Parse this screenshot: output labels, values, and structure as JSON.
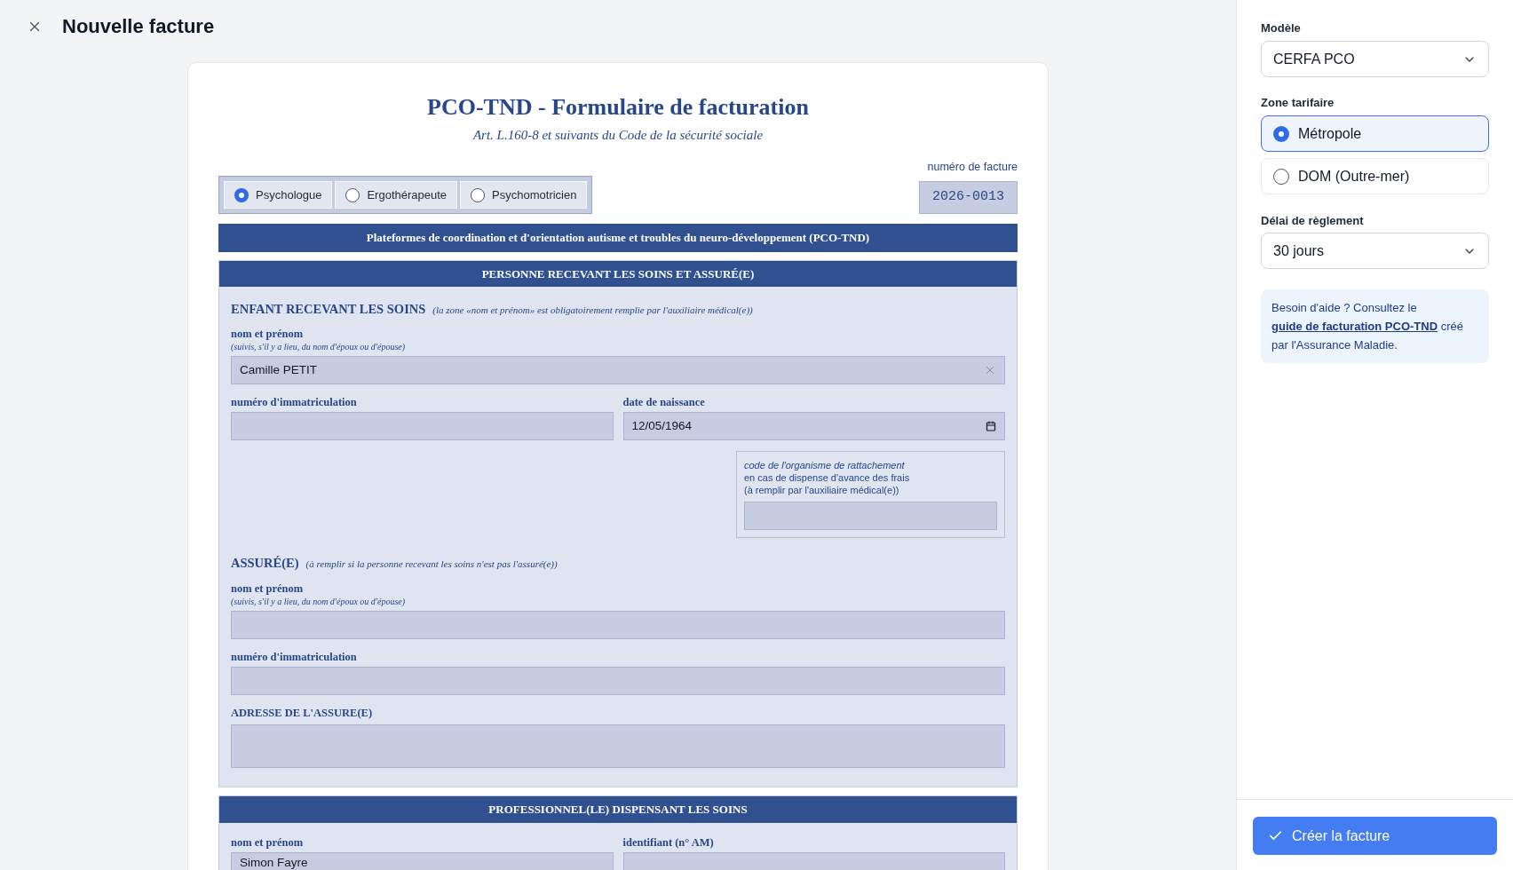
{
  "header": {
    "title": "Nouvelle facture"
  },
  "form": {
    "title": "PCO-TND - Formulaire de facturation",
    "subtitle": "Art. L.160-8 et suivants du Code de la sécurité sociale",
    "professions": [
      {
        "label": "Psychologue",
        "selected": true
      },
      {
        "label": "Ergothérapeute",
        "selected": false
      },
      {
        "label": "Psychomotricien",
        "selected": false
      }
    ],
    "invoice_number": {
      "label": "numéro de facture",
      "value": "2026-0013"
    },
    "banner": "Plateformes de coordination et d'orientation autisme et troubles du neuro-développement (PCO-TND)",
    "patient_section": {
      "heading": "PERSONNE RECEVANT LES SOINS ET ASSURÉ(E)",
      "child": {
        "title": "ENFANT RECEVANT LES SOINS",
        "note": "(la zone «nom et prénom» est obligatoirement remplie par l'auxiliaire médical(e))",
        "name": {
          "label": "nom et prénom",
          "hint": "(suivis, s'il y a lieu, du nom d'époux ou d'épouse)",
          "value": "Camille PETIT"
        },
        "registration": {
          "label": "numéro d'immatriculation"
        },
        "birth_date": {
          "label": "date de naissance",
          "value": "12/05/1964"
        },
        "organism_code": {
          "title": "code de l'organisme de rattachement",
          "lines": [
            "en cas de dispense d'avance des frais",
            "(à remplir par l'auxiliaire médical(e))"
          ]
        }
      },
      "insured": {
        "title": "ASSURÉ(E)",
        "note": "(à remplir si la personne recevant les soins n'est pas l'assuré(e))",
        "name": {
          "label": "nom et prénom",
          "hint": "(suivis, s'il y a lieu, du nom d'époux ou d'épouse)"
        },
        "registration": {
          "label": "numéro d'immatriculation"
        },
        "address": {
          "label": "ADRESSE DE L'ASSURE(E)"
        }
      }
    },
    "professional_section": {
      "heading": "PROFESSIONNEL(LE) DISPENSANT LES SOINS",
      "name": {
        "label": "nom et prénom",
        "value": "Simon Fayre"
      },
      "identifier": {
        "label": "identifiant (n° AM)"
      }
    }
  },
  "sidebar": {
    "model": {
      "label": "Modèle",
      "value": "CERFA PCO"
    },
    "zone": {
      "label": "Zone tarifaire",
      "options": [
        {
          "label": "Métropole",
          "selected": true
        },
        {
          "label": "DOM (Outre-mer)",
          "selected": false
        }
      ]
    },
    "payment_delay": {
      "label": "Délai de règlement",
      "value": "30 jours"
    },
    "help": {
      "before": "Besoin d'aide ? Consultez le",
      "link": "guide de facturation PCO-TND",
      "after": "créé par l'Assurance Maladie."
    }
  },
  "submit": {
    "label": "Créer la facture"
  }
}
